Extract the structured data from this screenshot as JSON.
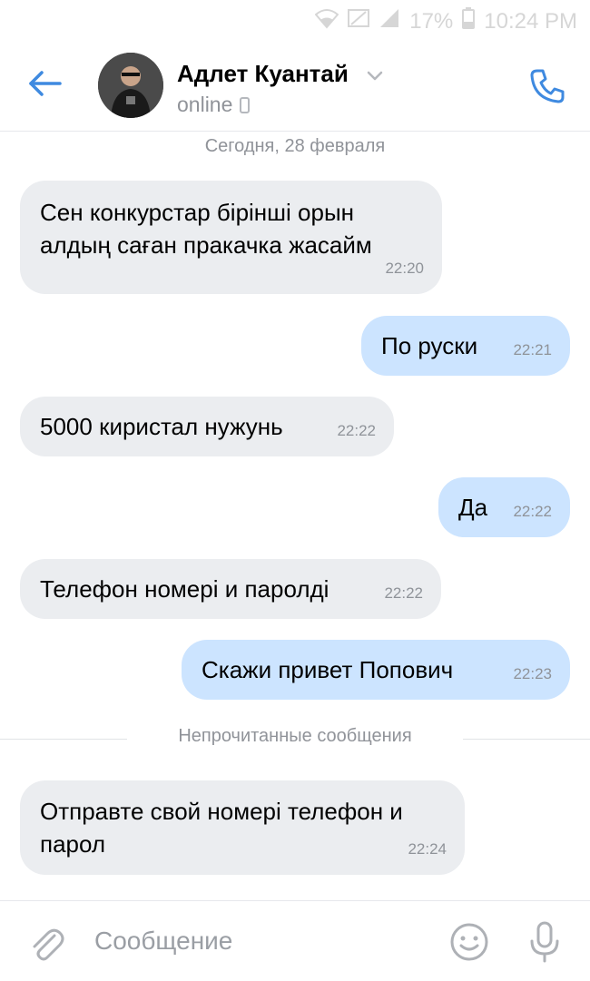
{
  "statusbar": {
    "battery_percent": "17%",
    "time": "10:24 PM",
    "icons": [
      "wifi-icon",
      "signal-off-icon",
      "signal-icon",
      "battery-icon"
    ]
  },
  "header": {
    "name": "Адлет Куантай",
    "status": "online",
    "icons": [
      "back-arrow-icon",
      "chevron-down-icon",
      "mobile-device-icon",
      "phone-call-icon"
    ],
    "accent": "#3f8ae0"
  },
  "conversation": {
    "date": "Сегодня, 28 февраля",
    "messages": [
      {
        "dir": "in",
        "lines": [
          "Сен конкурстар бірінші орын",
          "алдың саған пракачка жасайм"
        ],
        "time": "22:20"
      },
      {
        "dir": "out",
        "lines": [
          "По руски"
        ],
        "time": "22:21"
      },
      {
        "dir": "in",
        "lines": [
          "5000 киристал нужунь"
        ],
        "time": "22:22"
      },
      {
        "dir": "out",
        "lines": [
          "Да"
        ],
        "time": "22:22"
      },
      {
        "dir": "in",
        "lines": [
          "Телефон номері и паролді"
        ],
        "time": "22:22"
      },
      {
        "dir": "out",
        "lines": [
          "Скажи привет Попович"
        ],
        "time": "22:23"
      },
      {
        "dir": "in",
        "lines": [
          "Отправте свой номері телефон и",
          "парол"
        ],
        "time": "22:24"
      }
    ],
    "unread_label": "Непрочитанные сообщения",
    "colors": {
      "incoming": "#ebedf0",
      "outgoing": "#cce4ff"
    }
  },
  "composer": {
    "placeholder": "Сообщение",
    "icons": [
      "paperclip-icon",
      "emoji-icon",
      "microphone-icon"
    ]
  }
}
